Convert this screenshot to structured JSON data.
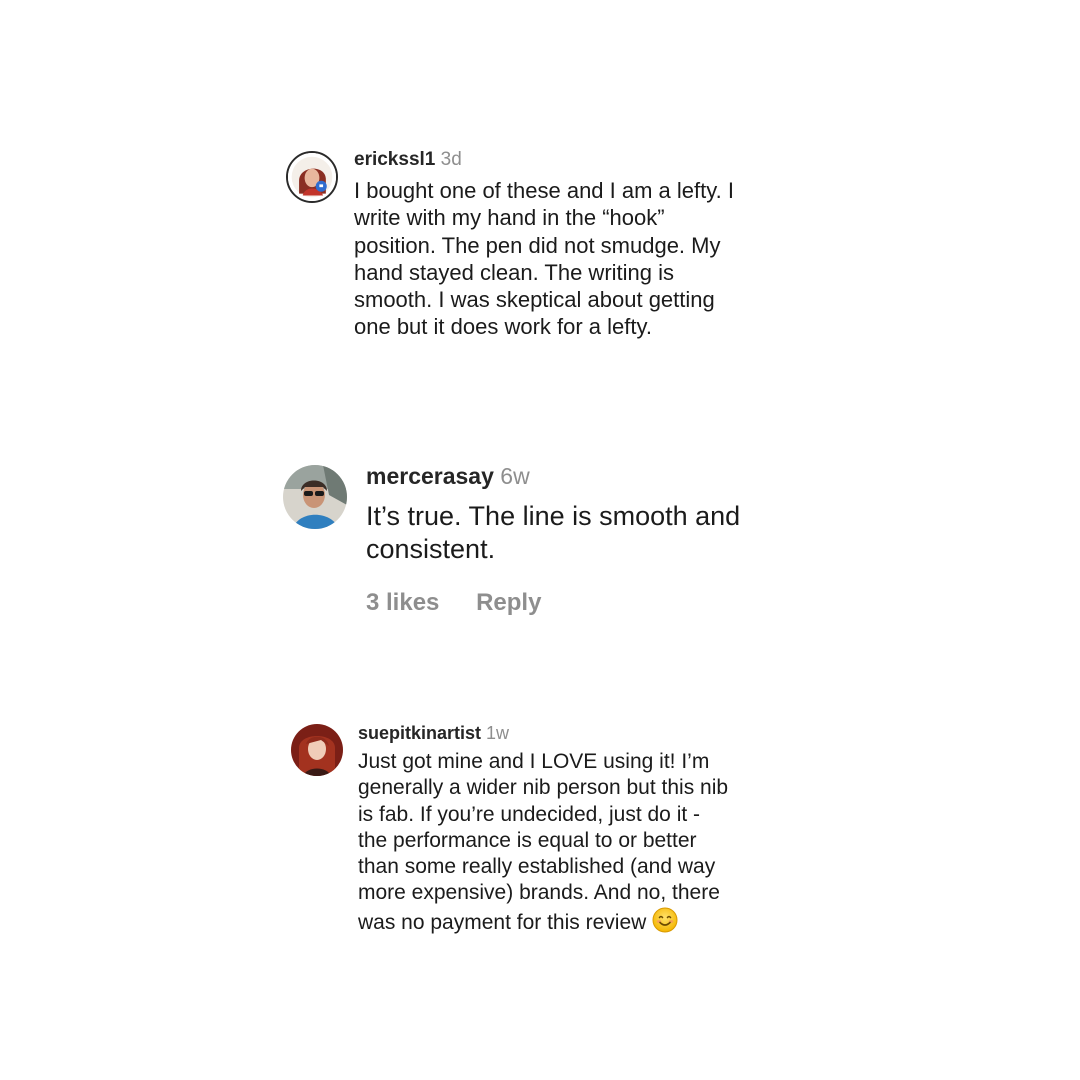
{
  "comments": [
    {
      "username": "erickssl1",
      "time": "3d",
      "text": "I bought one of these and I am a lefty. I\nwrite with my hand in the “hook”\nposition.  The pen did not smudge. My\nhand stayed clean.  The writing is\nsmooth.  I was skeptical about getting\none but it does work for a lefty."
    },
    {
      "username": "mercerasay",
      "time": "6w",
      "text": "It’s true.  The line is smooth and\nconsistent.",
      "likes": "3 likes",
      "reply": "Reply"
    },
    {
      "username": "suepitkinartist",
      "time": "1w",
      "text": "Just got mine and I LOVE using it! I’m\ngenerally a wider nib person but this nib\nis fab.  If you’re undecided, just do it -\nthe performance is equal to or better\nthan some really established (and way\nmore expensive) brands.  And no, there\nwas no payment for this review",
      "emoji": "smiling-face-icon"
    }
  ],
  "colors": {
    "text": "#1b1b1b",
    "muted": "#8e8e8e",
    "background": "#ffffff"
  }
}
